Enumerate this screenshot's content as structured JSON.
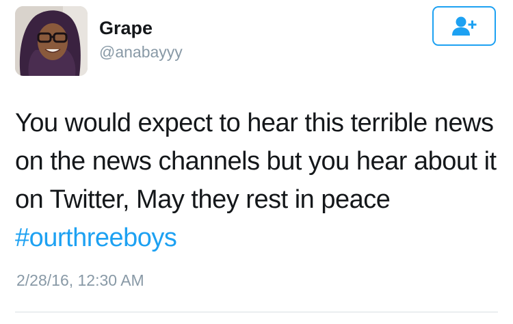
{
  "tweet": {
    "author": {
      "name": "Grape",
      "handle": "@anabayyy"
    },
    "follow_button": {
      "icon": "add-user-icon",
      "color": "#1da1f2"
    },
    "text": "You would expect to hear this terrible news on the news channels but you hear about it on Twitter, May they rest in peace",
    "hashtag": "#ourthreeboys",
    "timestamp": "2/28/16, 12:30 AM"
  },
  "colors": {
    "accent": "#1da1f2",
    "text": "#14171a",
    "muted": "#8899a6"
  }
}
